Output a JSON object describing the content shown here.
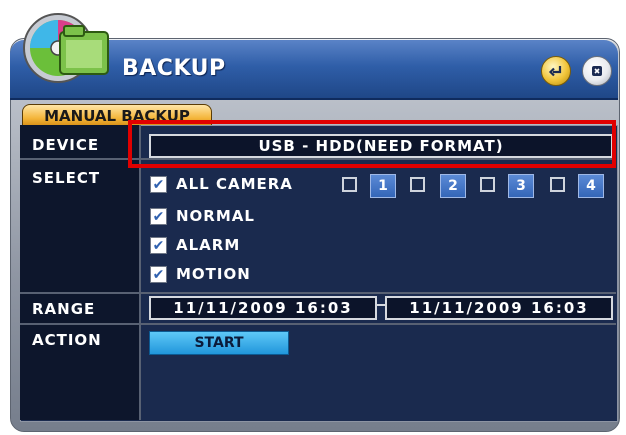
{
  "window": {
    "title": "BACKUP"
  },
  "tab": {
    "label": "MANUAL BACKUP"
  },
  "rows": {
    "device": "DEVICE",
    "select": "SELECT",
    "range": "RANGE",
    "action": "ACTION"
  },
  "device": {
    "value": "USB - HDD(NEED FORMAT)"
  },
  "select": {
    "all_camera": {
      "label": "ALL CAMERA",
      "checked": true
    },
    "cameras": [
      {
        "label": "1",
        "checked": false
      },
      {
        "label": "2",
        "checked": false
      },
      {
        "label": "3",
        "checked": false
      },
      {
        "label": "4",
        "checked": false
      }
    ],
    "normal": {
      "label": "NORMAL",
      "checked": true
    },
    "alarm": {
      "label": "ALARM",
      "checked": true
    },
    "motion": {
      "label": "MOTION",
      "checked": true
    }
  },
  "range": {
    "from": "11/11/2009  16:03",
    "to": "11/11/2009  16:03"
  },
  "action": {
    "start_label": "START"
  },
  "icons": {
    "enter": "enter-icon",
    "exit": "close-icon"
  },
  "colors": {
    "highlight": "#e00000",
    "panel": "#1a2a4e",
    "title_bar": "#2f5ea8",
    "tab": "#f4b53a"
  }
}
